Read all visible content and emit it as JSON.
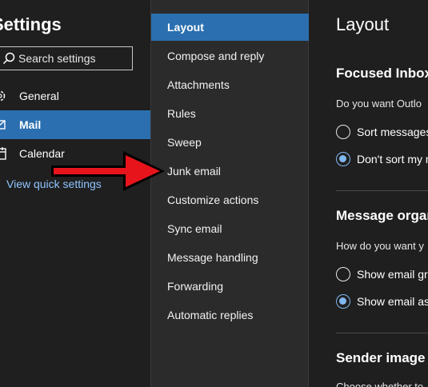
{
  "sidebar": {
    "title": "Settings",
    "search_placeholder": "Search settings",
    "items": [
      {
        "label": "General",
        "icon": "gear-icon"
      },
      {
        "label": "Mail",
        "icon": "mail-icon"
      },
      {
        "label": "Calendar",
        "icon": "calendar-icon"
      }
    ],
    "quick_settings_link": "View quick settings"
  },
  "mail_menu": {
    "items": [
      "Layout",
      "Compose and reply",
      "Attachments",
      "Rules",
      "Sweep",
      "Junk email",
      "Customize actions",
      "Sync email",
      "Message handling",
      "Forwarding",
      "Automatic replies"
    ],
    "selected": "Layout"
  },
  "content": {
    "title": "Layout",
    "focused_inbox": {
      "heading": "Focused Inbox",
      "question": "Do you want Outlo",
      "options": [
        "Sort messages",
        "Don't sort my m"
      ]
    },
    "message_organization": {
      "heading": "Message organ",
      "question": "How do you want y",
      "options": [
        "Show email gro",
        "Show email as"
      ]
    },
    "sender_image": {
      "heading": "Sender image",
      "partial_text": "Choose whether to"
    }
  },
  "colors": {
    "accent": "#2b6fb0",
    "link": "#8fc5ff",
    "arrow": "#e8141c"
  }
}
